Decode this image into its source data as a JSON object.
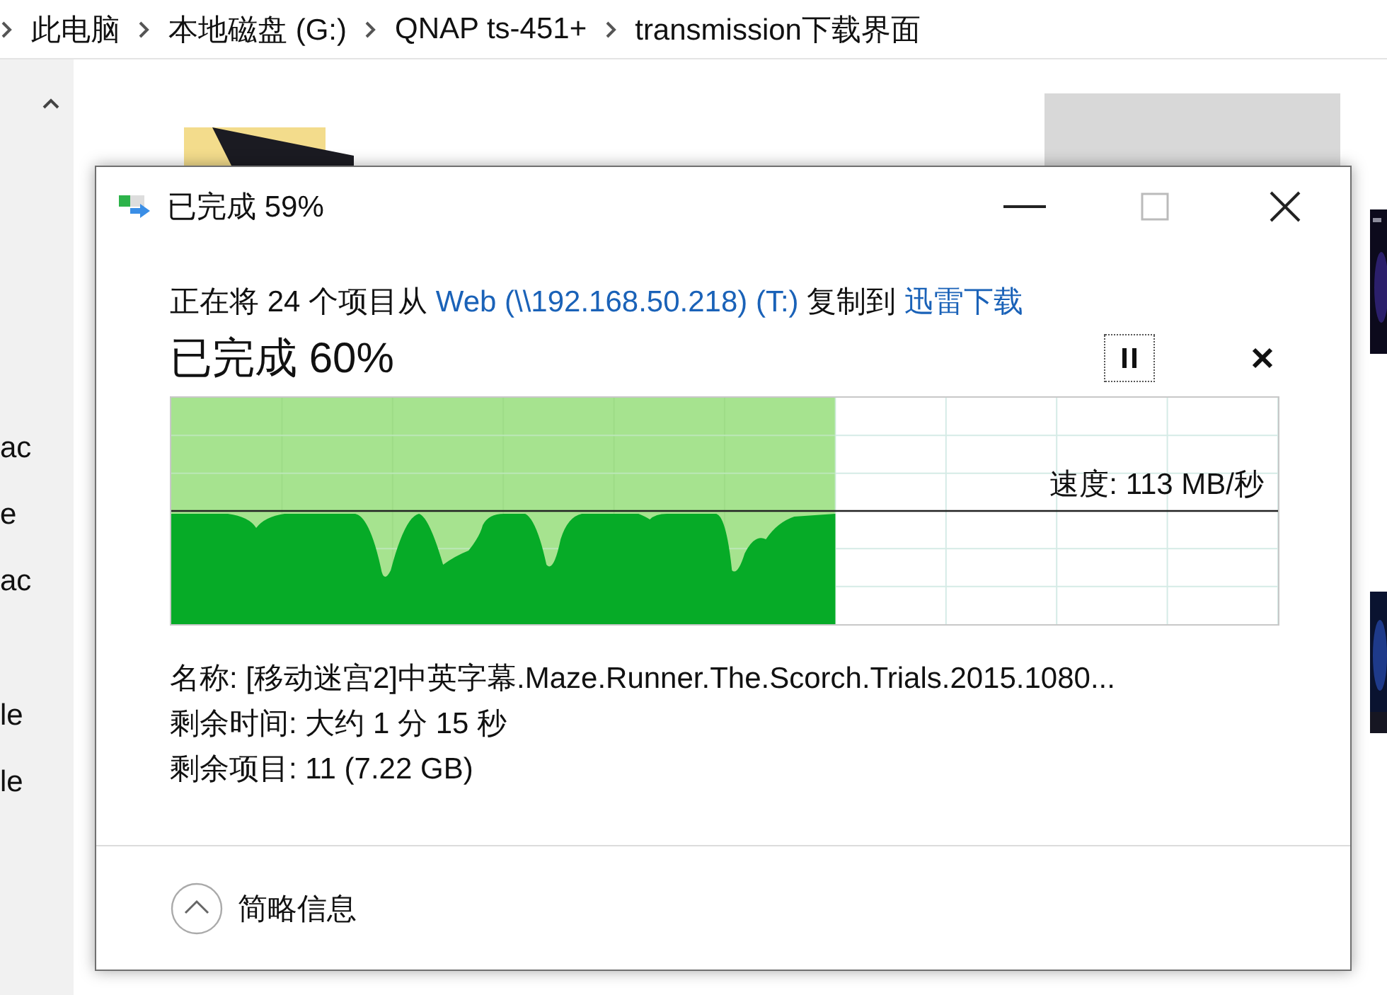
{
  "breadcrumb": [
    {
      "label": "此电脑"
    },
    {
      "label": "本地磁盘 (G:)"
    },
    {
      "label": "QNAP ts-451+"
    },
    {
      "label": "transmission下载界面"
    }
  ],
  "nav": {
    "items": [
      "ac",
      "e",
      "ac",
      "le",
      "le"
    ]
  },
  "dialog": {
    "title": "已完成 59%",
    "description": {
      "prefix": "正在将 24 个项目从 ",
      "source": "Web (\\\\192.168.50.218) (T:)",
      "middle": " 复制到 ",
      "destination": "迅雷下载"
    },
    "heading": "已完成 60%",
    "progress": {
      "level": 0.6,
      "speed": "速度: 113 MB/秒"
    },
    "details": [
      "名称: [移动迷宫2]中英字幕.Maze.Runner.The.Scorch.Trials.2015.1080...",
      "剩余时间: 大约 1 分 15 秒",
      "剩余项目: 11 (7.22 GB)"
    ],
    "footer": {
      "label": "简略信息",
      "expanded": true
    }
  }
}
